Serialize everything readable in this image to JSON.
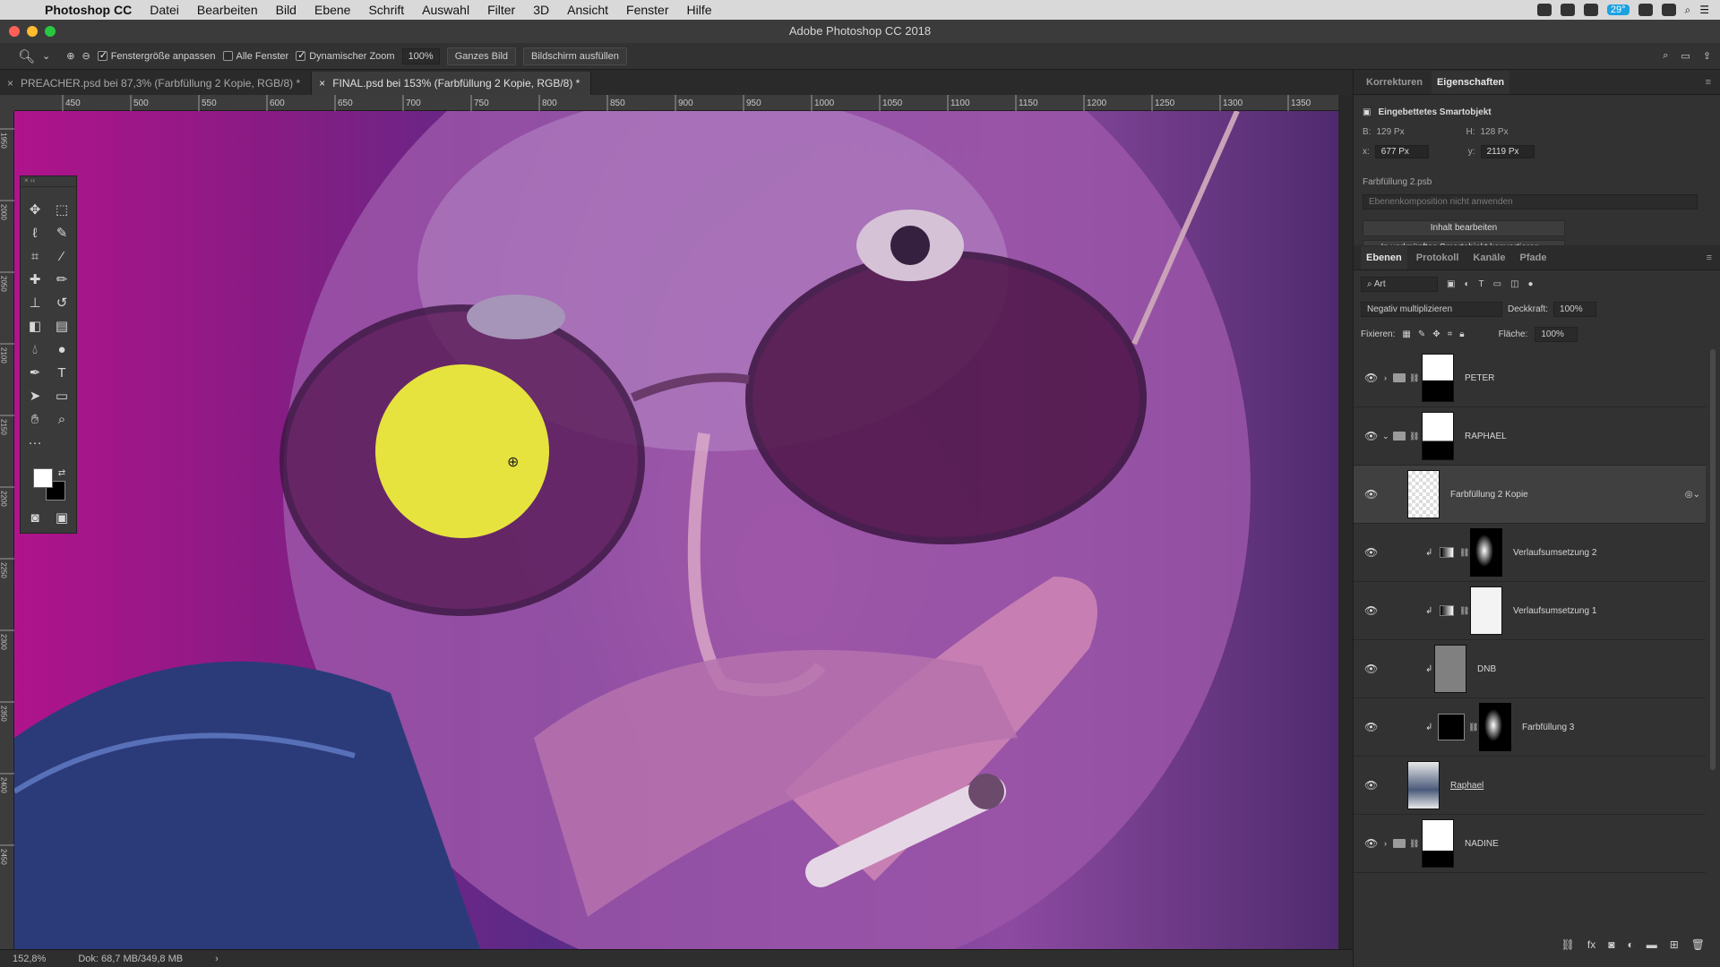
{
  "menubar": {
    "app_name": "Photoshop CC",
    "items": [
      "Datei",
      "Bearbeiten",
      "Bild",
      "Ebene",
      "Schrift",
      "Auswahl",
      "Filter",
      "3D",
      "Ansicht",
      "Fenster",
      "Hilfe"
    ],
    "temperature": "29°"
  },
  "window": {
    "title": "Adobe Photoshop CC 2018"
  },
  "options_bar": {
    "check_resize": "Fenstergröße anpassen",
    "check_all_windows": "Alle Fenster",
    "check_dynamic_zoom": "Dynamischer Zoom",
    "zoom_value": "100%",
    "btn_fit": "Ganzes Bild",
    "btn_fill": "Bildschirm ausfüllen"
  },
  "tabs": [
    {
      "label": "PREACHER.psd bei 87,3% (Farbfüllung 2 Kopie, RGB/8) *"
    },
    {
      "label": "FINAL.psd bei 153% (Farbfüllung 2 Kopie, RGB/8) *"
    }
  ],
  "ruler": {
    "h_ticks": [
      "450",
      "500",
      "550",
      "600",
      "650",
      "700",
      "750",
      "800",
      "850",
      "900",
      "950",
      "1000",
      "1050",
      "1100",
      "1150",
      "1200",
      "1250",
      "1300",
      "1350"
    ],
    "v_ticks": [
      "1950",
      "2000",
      "2050",
      "2100",
      "2150",
      "2200",
      "2250",
      "2300",
      "2350",
      "2400",
      "2450"
    ]
  },
  "status": {
    "zoom": "152,8%",
    "doc": "Dok: 68,7 MB/349,8 MB"
  },
  "properties_panel": {
    "tabs": [
      "Korrekturen",
      "Eigenschaften"
    ],
    "active_tab": "Eigenschaften",
    "header": "Eingebettetes Smartobjekt",
    "w_label": "B:",
    "w_value": "129 Px",
    "h_label": "H:",
    "h_value": "128 Px",
    "x_label": "x:",
    "x_value": "677 Px",
    "y_label": "y:",
    "y_value": "2119 Px",
    "source": "Farbfüllung 2.psb",
    "comp_placeholder": "Ebenenkomposition nicht anwenden",
    "btn_edit": "Inhalt bearbeiten",
    "btn_convert": "In verknüpftes Smartobjekt konvertieren..."
  },
  "layers_panel": {
    "tabs": [
      "Ebenen",
      "Protokoll",
      "Kanäle",
      "Pfade"
    ],
    "active_tab": "Ebenen",
    "filter_label": "Art",
    "blend_mode": "Negativ multiplizieren",
    "opacity_label": "Deckkraft:",
    "opacity_value": "100%",
    "lock_label": "Fixieren:",
    "fill_label": "Fläche:",
    "fill_value": "100%",
    "layers": [
      {
        "name": "PETER",
        "type": "group"
      },
      {
        "name": "RAPHAEL",
        "type": "group-open"
      },
      {
        "name": "Farbfüllung 2 Kopie",
        "type": "smart",
        "selected": true
      },
      {
        "name": "Verlaufsumsetzung 2",
        "type": "adjust"
      },
      {
        "name": "Verlaufsumsetzung 1",
        "type": "adjust"
      },
      {
        "name": "DNB",
        "type": "gray"
      },
      {
        "name": "Farbfüllung 3",
        "type": "fill"
      },
      {
        "name": "Raphael",
        "type": "smart-photo"
      },
      {
        "name": "NADINE",
        "type": "group"
      }
    ]
  },
  "colors": {
    "accent_circle": "#e6e33f",
    "foreground": "#ffffff",
    "background": "#000000"
  }
}
